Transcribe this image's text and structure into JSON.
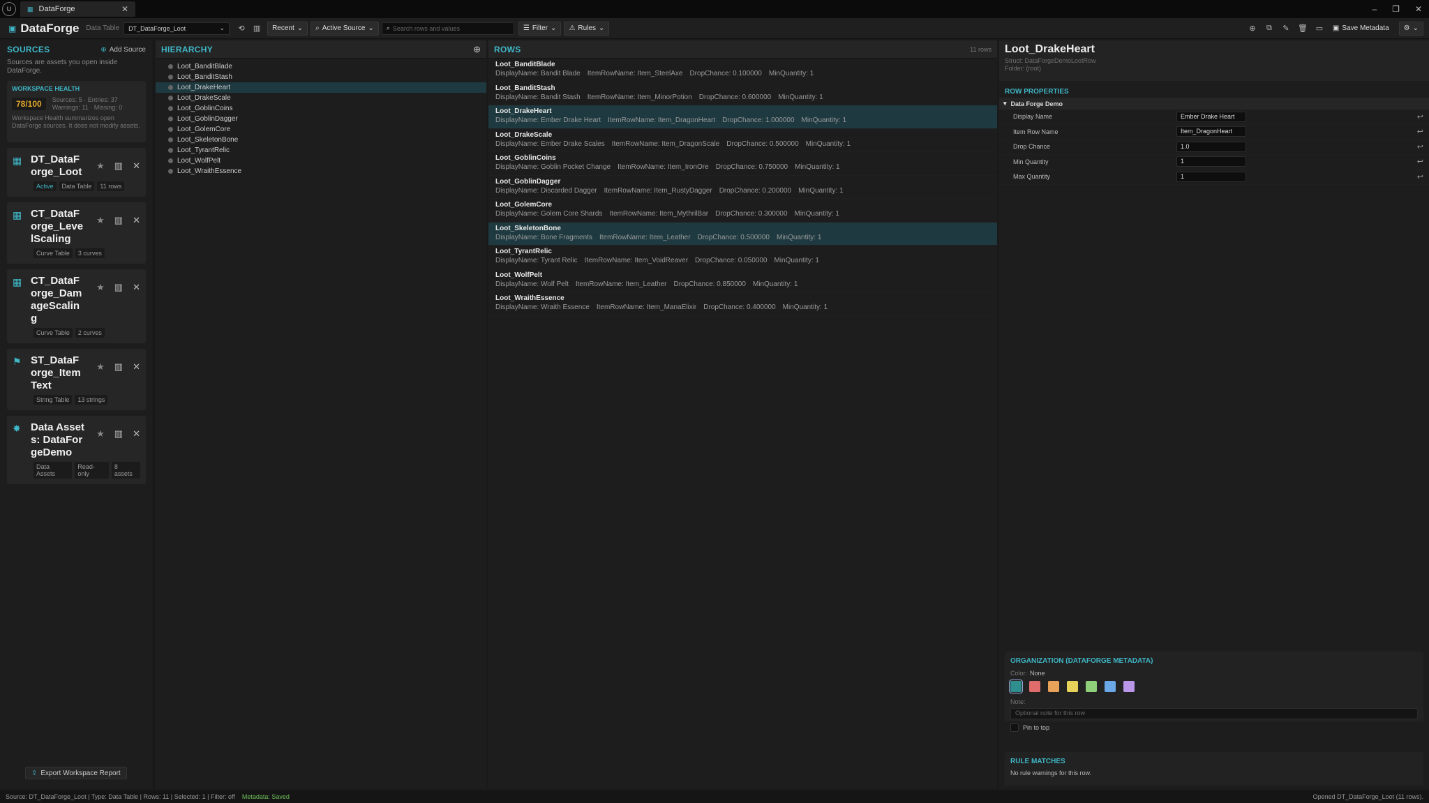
{
  "window": {
    "tab_title": "DataForge",
    "app_title": "DataForge",
    "mode_label": "Data Table",
    "controls": {
      "minimize": "–",
      "restore": "❐",
      "close": "✕"
    }
  },
  "toolbar": {
    "source_select": "DT_DataForge_Loot",
    "recent_label": "Recent",
    "active_source_label": "Active Source",
    "search_placeholder": "Search rows and values",
    "filter_label": "Filter",
    "rules_label": "Rules",
    "save_metadata_label": "Save Metadata"
  },
  "sources": {
    "title": "SOURCES",
    "add_label": "Add Source",
    "description": "Sources are assets you open inside DataForge.",
    "health": {
      "title": "WORKSPACE HEALTH",
      "score": "78/100",
      "stats_line1": "Sources: 5 · Entries: 37",
      "stats_line2": "Warnings: 11 · Missing: 0",
      "note": "Workspace Health summarizes open DataForge sources. It does not modify assets."
    },
    "items": [
      {
        "name": "DT_DataForge_Loot",
        "tags": [
          "Active",
          "Data Table",
          "11 rows"
        ],
        "icon": "table-icon"
      },
      {
        "name": "CT_DataForge_LevelScaling",
        "tags": [
          "Curve Table",
          "3 curves"
        ],
        "icon": "curve-table-icon"
      },
      {
        "name": "CT_DataForge_DamageScaling",
        "tags": [
          "Curve Table",
          "2 curves"
        ],
        "icon": "curve-table-icon"
      },
      {
        "name": "ST_DataForge_ItemText",
        "tags": [
          "String Table",
          "13 strings"
        ],
        "icon": "flag-icon"
      },
      {
        "name": "Data Assets: DataForgeDemo",
        "tags": [
          "Data Assets",
          "Read-only",
          "8 assets"
        ],
        "icon": "gear-icon"
      }
    ],
    "export_label": "Export Workspace Report"
  },
  "hierarchy": {
    "title": "HIERARCHY",
    "items": [
      "Loot_BanditBlade",
      "Loot_BanditStash",
      "Loot_DrakeHeart",
      "Loot_DrakeScale",
      "Loot_GoblinCoins",
      "Loot_GoblinDagger",
      "Loot_GolemCore",
      "Loot_SkeletonBone",
      "Loot_TyrantRelic",
      "Loot_WolfPelt",
      "Loot_WraithEssence"
    ],
    "selected_index": 2
  },
  "rows": {
    "title": "ROWS",
    "count": "11 rows",
    "items": [
      {
        "name": "Loot_BanditBlade",
        "display": "DisplayName: Bandit Blade",
        "item": "ItemRowName: Item_SteelAxe",
        "drop": "DropChance: 0.100000",
        "minq": "MinQuantity: 1"
      },
      {
        "name": "Loot_BanditStash",
        "display": "DisplayName: Bandit Stash",
        "item": "ItemRowName: Item_MinorPotion",
        "drop": "DropChance: 0.600000",
        "minq": "MinQuantity: 1"
      },
      {
        "name": "Loot_DrakeHeart",
        "display": "DisplayName: Ember Drake Heart",
        "item": "ItemRowName: Item_DragonHeart",
        "drop": "DropChance: 1.000000",
        "minq": "MinQuantity: 1"
      },
      {
        "name": "Loot_DrakeScale",
        "display": "DisplayName: Ember Drake Scales",
        "item": "ItemRowName: Item_DragonScale",
        "drop": "DropChance: 0.500000",
        "minq": "MinQuantity: 1"
      },
      {
        "name": "Loot_GoblinCoins",
        "display": "DisplayName: Goblin Pocket Change",
        "item": "ItemRowName: Item_IronOre",
        "drop": "DropChance: 0.750000",
        "minq": "MinQuantity: 1"
      },
      {
        "name": "Loot_GoblinDagger",
        "display": "DisplayName: Discarded Dagger",
        "item": "ItemRowName: Item_RustyDagger",
        "drop": "DropChance: 0.200000",
        "minq": "MinQuantity: 1"
      },
      {
        "name": "Loot_GolemCore",
        "display": "DisplayName: Golem Core Shards",
        "item": "ItemRowName: Item_MythrilBar",
        "drop": "DropChance: 0.300000",
        "minq": "MinQuantity: 1"
      },
      {
        "name": "Loot_SkeletonBone",
        "display": "DisplayName: Bone Fragments",
        "item": "ItemRowName: Item_Leather",
        "drop": "DropChance: 0.500000",
        "minq": "MinQuantity: 1"
      },
      {
        "name": "Loot_TyrantRelic",
        "display": "DisplayName: Tyrant Relic",
        "item": "ItemRowName: Item_VoidReaver",
        "drop": "DropChance: 0.050000",
        "minq": "MinQuantity: 1"
      },
      {
        "name": "Loot_WolfPelt",
        "display": "DisplayName: Wolf Pelt",
        "item": "ItemRowName: Item_Leather",
        "drop": "DropChance: 0.850000",
        "minq": "MinQuantity: 1"
      },
      {
        "name": "Loot_WraithEssence",
        "display": "DisplayName: Wraith Essence",
        "item": "ItemRowName: Item_ManaElixir",
        "drop": "DropChance: 0.400000",
        "minq": "MinQuantity: 1"
      }
    ],
    "selected_indices": [
      2,
      7
    ]
  },
  "details": {
    "title": "Loot_DrakeHeart",
    "struct": "Struct: DataForgeDemoLootRow",
    "folder": "Folder: (root)",
    "row_props_title": "ROW PROPERTIES",
    "category": "Data Forge Demo",
    "props": [
      {
        "label": "Display Name",
        "value": "Ember Drake Heart"
      },
      {
        "label": "Item Row Name",
        "value": "Item_DragonHeart"
      },
      {
        "label": "Drop Chance",
        "value": "1.0"
      },
      {
        "label": "Min Quantity",
        "value": "1"
      },
      {
        "label": "Max Quantity",
        "value": "1"
      }
    ],
    "org": {
      "title": "ORGANIZATION (DATAFORGE METADATA)",
      "color_label": "Color:",
      "color_value": "None",
      "swatches": [
        "#2f8f8f",
        "#e06c6c",
        "#e8a25a",
        "#e8d35a",
        "#8fcf7a",
        "#6aa8e8",
        "#b996e8"
      ],
      "note_label": "Note:",
      "note_placeholder": "Optional note for this row",
      "pin_label": "Pin to top"
    },
    "rules": {
      "title": "RULE MATCHES",
      "text": "No rule warnings for this row."
    }
  },
  "status": {
    "left": "Source: DT_DataForge_Loot | Type: Data Table | Rows: 11 | Selected: 1 | Filter: off",
    "metadata": "Metadata: Saved",
    "right": "Opened DT_DataForge_Loot (11 rows)."
  },
  "colors": {
    "accent": "#3fb7c7",
    "score": "#e0a52b",
    "selection": "#1e3a40",
    "saved": "#6fbf5a"
  }
}
